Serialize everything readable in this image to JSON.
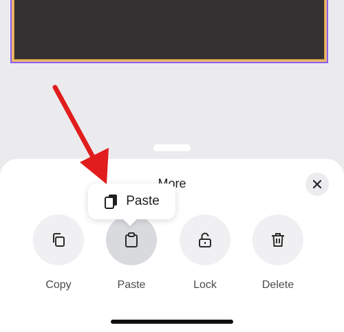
{
  "sheet": {
    "title": "More",
    "close_icon": "close-icon"
  },
  "tooltip": {
    "label": "Paste",
    "icon": "paste-icon"
  },
  "actions": [
    {
      "label": "Copy",
      "icon": "copy-icon"
    },
    {
      "label": "Paste",
      "icon": "clipboard-icon"
    },
    {
      "label": "Lock",
      "icon": "lock-icon"
    },
    {
      "label": "Delete",
      "icon": "trash-icon"
    }
  ],
  "colors": {
    "selection_border": "#8b5cf6",
    "element_fill": "#333131",
    "element_frame": "#e7b96a",
    "annotation_arrow": "#e11d1d"
  }
}
